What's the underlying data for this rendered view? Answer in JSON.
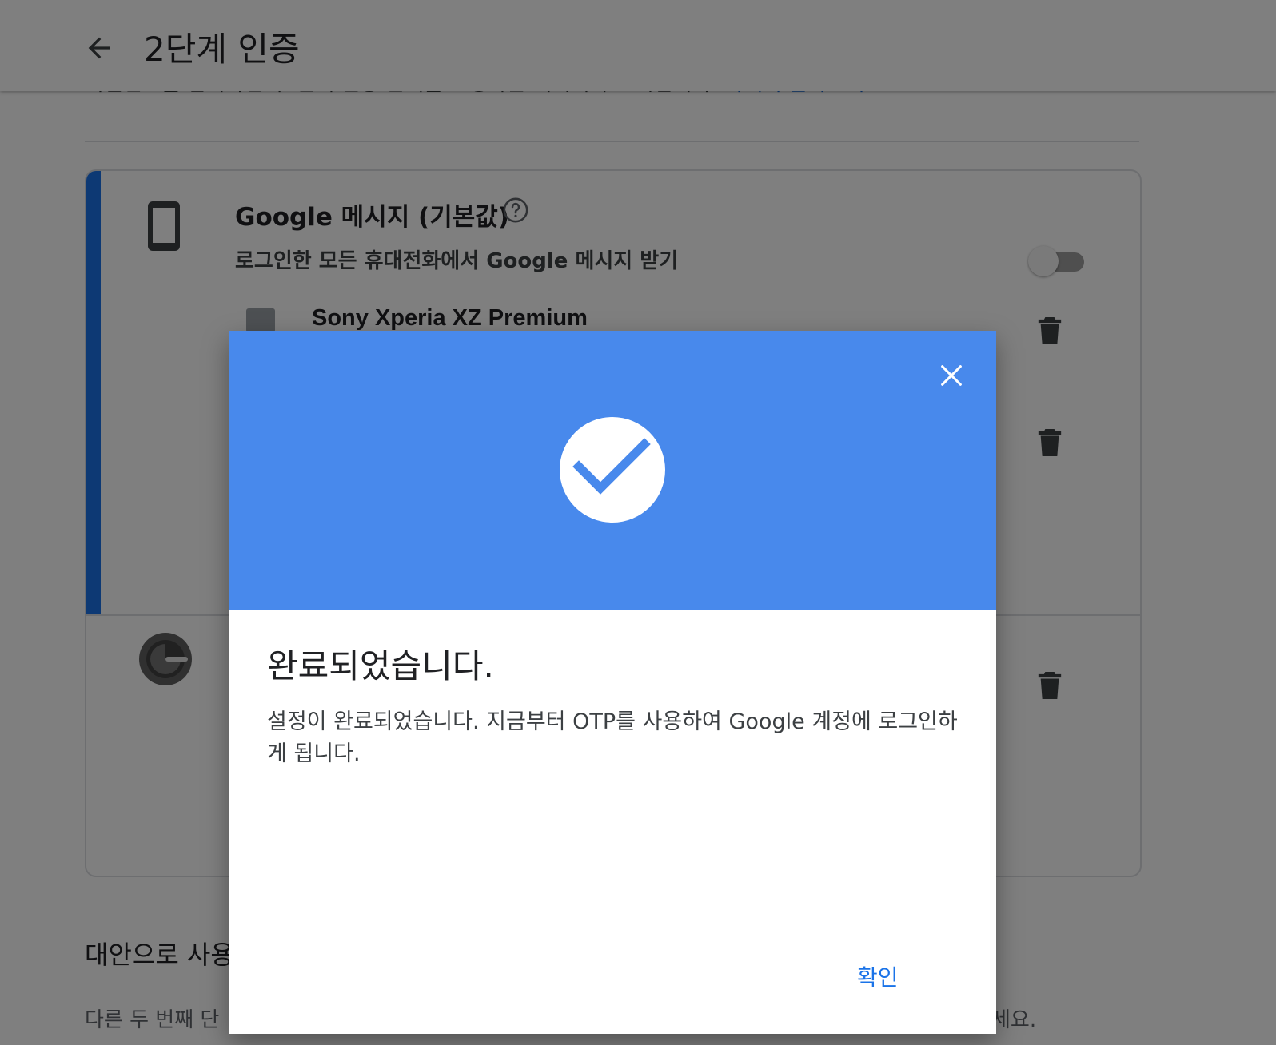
{
  "header": {
    "back_label": "←",
    "title": "2단계 인증"
  },
  "background": {
    "intro_text": "비밀번호를 입력하면 두 번째 인증 단계를 요청하는 메시지가 표시됩니다.",
    "intro_link": "자세히 알아보기",
    "google_prompt": {
      "title": "Google 메시지 (기본값)",
      "subtitle": "로그인한 모든 휴대전화에서 Google 메시지 받기",
      "toggle_on": false
    },
    "device": {
      "name": "Sony Xperia XZ Premium"
    },
    "alt_section": {
      "title": "대안으로 사용",
      "description": "다른 두 번째 단",
      "description_end": "세요."
    }
  },
  "dialog": {
    "title": "완료되었습니다.",
    "body": "설정이 완료되었습니다. 지금부터 OTP를 사용하여 Google 계정에 로그인하게 됩니다.",
    "ok_label": "확인",
    "hero_color": "#4889ec"
  },
  "colors": {
    "accent": "#1a73e8",
    "scrim": "rgba(0,0,0,0.5)"
  },
  "icons": [
    "arrow-back-icon",
    "phone-icon",
    "help-icon",
    "delete-icon",
    "authenticator-icon",
    "close-icon",
    "check-circle-icon"
  ]
}
